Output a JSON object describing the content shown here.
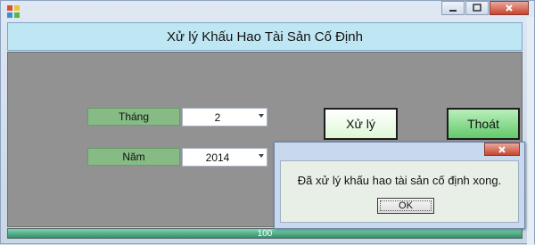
{
  "window": {
    "title_controls": [
      "minimize",
      "maximize",
      "close"
    ]
  },
  "form": {
    "title": "Xử lý Khấu Hao Tài Sản Cố Định",
    "month": {
      "label": "Tháng",
      "value": "2"
    },
    "year": {
      "label": "Năm",
      "value": "2014"
    },
    "process_button": "Xử lý",
    "exit_button": "Thoát",
    "progress": {
      "percent": 100,
      "text": "100"
    }
  },
  "messagebox": {
    "message": "Đã xử lý khấu hao tài sản cố định xong.",
    "ok_label": "OK"
  },
  "colors": {
    "title_bg": "#bfe6f3",
    "panel_bg": "#929292",
    "label_bg": "#86bb86",
    "exit_btn": "#63c96a",
    "progress_fill": "#2f8f67"
  }
}
